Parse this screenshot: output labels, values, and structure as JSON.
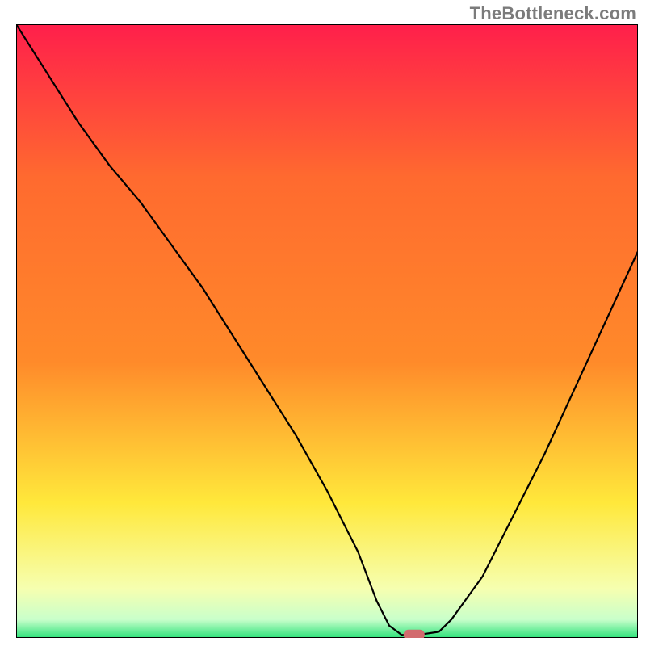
{
  "attribution": "TheBottleneck.com",
  "chart_data": {
    "type": "line",
    "title": "",
    "xlabel": "",
    "ylabel": "",
    "xlim": [
      0,
      100
    ],
    "ylim": [
      0,
      100
    ],
    "grid": false,
    "legend": false,
    "series": [
      {
        "name": "curve",
        "color": "#000000",
        "x": [
          0,
          5,
          10,
          15,
          20,
          25,
          30,
          35,
          40,
          45,
          50,
          55,
          58,
          60,
          62,
          64,
          66,
          68,
          70,
          75,
          80,
          85,
          90,
          95,
          100
        ],
        "y": [
          100,
          92,
          84,
          77,
          71,
          64,
          57,
          49,
          41,
          33,
          24,
          14,
          6,
          2,
          0.5,
          0.5,
          0.7,
          1,
          3,
          10,
          20,
          30,
          41,
          52,
          63
        ]
      }
    ],
    "marker": {
      "name": "optimal-point",
      "x": 64,
      "y": 0.5,
      "color": "#d26b6e",
      "shape": "pill"
    },
    "background_gradient": {
      "top_color": "#ff1f4b",
      "mid_color_1": "#ff8a2a",
      "mid_color_2": "#ffe83b",
      "bottom_band_color": "#2de27a",
      "bottom_band_fraction": 0.025
    }
  }
}
